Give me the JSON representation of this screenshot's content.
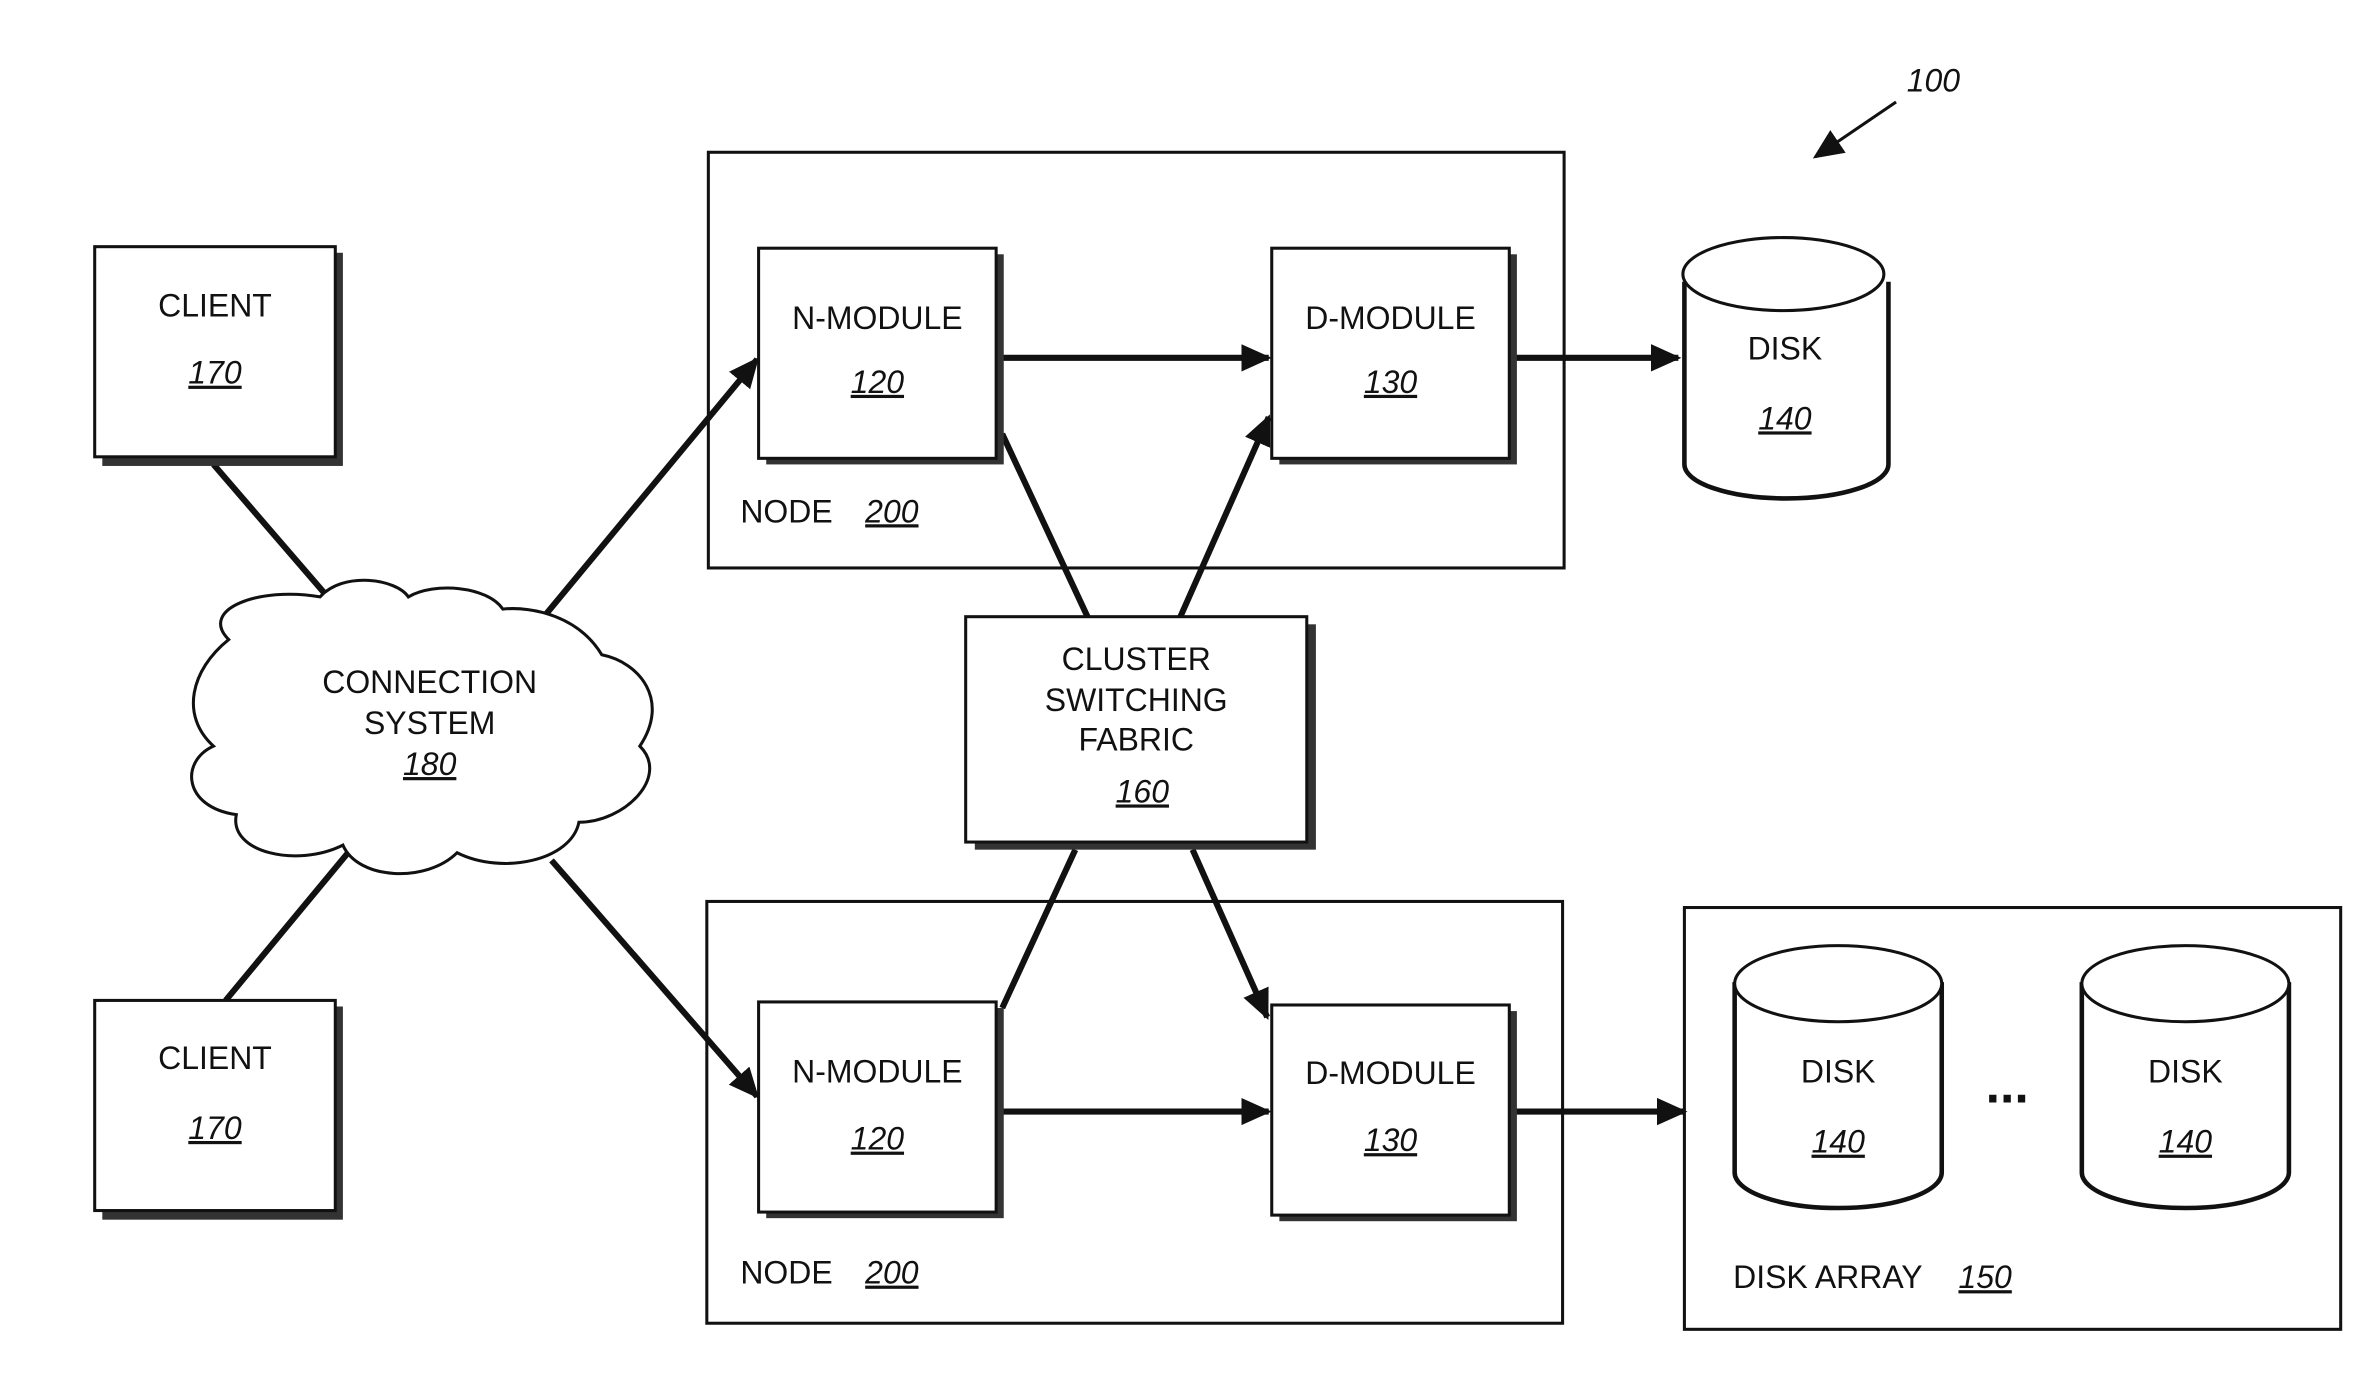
{
  "figure_ref": "100",
  "clients": [
    {
      "label": "CLIENT",
      "ref": "170"
    },
    {
      "label": "CLIENT",
      "ref": "170"
    }
  ],
  "connection_system": {
    "label_line1": "CONNECTION",
    "label_line2": "SYSTEM",
    "ref": "180"
  },
  "nodes": [
    {
      "label": "NODE",
      "ref": "200",
      "n_module": {
        "label": "N-MODULE",
        "ref": "120"
      },
      "d_module": {
        "label": "D-MODULE",
        "ref": "130"
      }
    },
    {
      "label": "NODE",
      "ref": "200",
      "n_module": {
        "label": "N-MODULE",
        "ref": "120"
      },
      "d_module": {
        "label": "D-MODULE",
        "ref": "130"
      }
    }
  ],
  "fabric": {
    "line1": "CLUSTER",
    "line2": "SWITCHING",
    "line3": "FABRIC",
    "ref": "160"
  },
  "disk": {
    "label": "DISK",
    "ref": "140"
  },
  "disk_array": {
    "label": "DISK ARRAY",
    "ref": "150",
    "disks": [
      {
        "label": "DISK",
        "ref": "140"
      },
      {
        "label": "DISK",
        "ref": "140"
      }
    ],
    "ellipsis": "..."
  }
}
